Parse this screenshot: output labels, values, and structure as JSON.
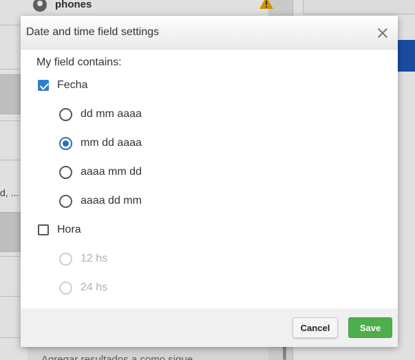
{
  "background": {
    "phones_label": "phones",
    "ellipsis_text": "d, ...",
    "bottom_text": "Agregar resultados a como sigue"
  },
  "dialog": {
    "title": "Date and time field settings",
    "intro_label": "My field contains:",
    "date_option": {
      "label": "Fecha",
      "checked": true
    },
    "date_formats": [
      {
        "label": "dd mm aaaa",
        "selected": false
      },
      {
        "label": "mm dd aaaa",
        "selected": true
      },
      {
        "label": "aaaa mm dd",
        "selected": false
      },
      {
        "label": "aaaa dd mm",
        "selected": false
      }
    ],
    "time_option": {
      "label": "Hora",
      "checked": false
    },
    "time_formats": [
      {
        "label": "12 hs",
        "selected": false,
        "disabled": true
      },
      {
        "label": "24 hs",
        "selected": false,
        "disabled": true
      }
    ],
    "cancel_label": "Cancel",
    "save_label": "Save"
  },
  "colors": {
    "accent": "#2f7fcf",
    "save_button": "#4cae4c",
    "header_blue": "#1f56b8",
    "warning": "#f0a500"
  },
  "icons": [
    "user-icon",
    "warning-icon",
    "close-icon",
    "check-icon"
  ]
}
